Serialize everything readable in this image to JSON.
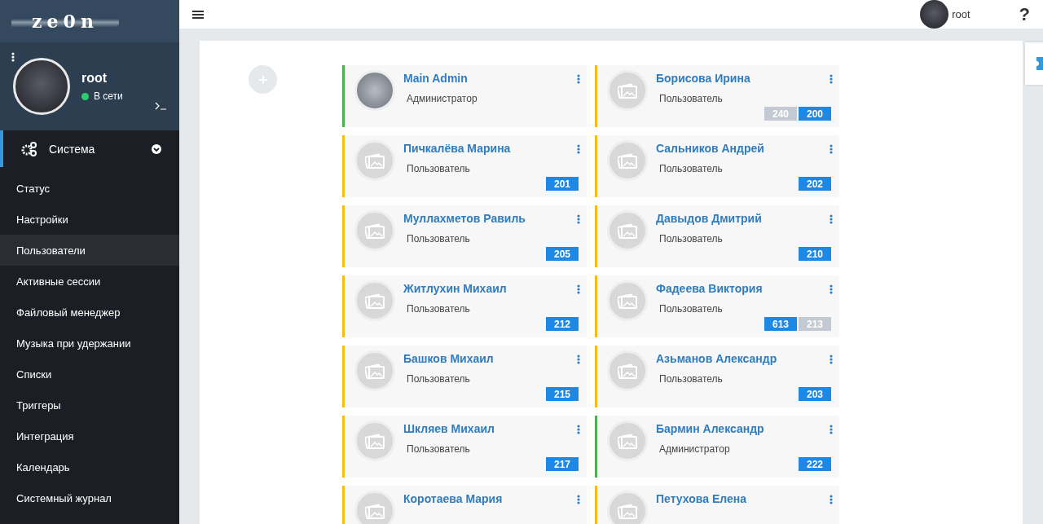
{
  "logo": {
    "text": "ze0n"
  },
  "profile": {
    "name": "root",
    "status": "В сети",
    "online": true
  },
  "header": {
    "user": "root",
    "help": "?"
  },
  "menu": {
    "section": "Система",
    "expanded": true,
    "items": [
      {
        "label": "Статус",
        "selected": false
      },
      {
        "label": "Настройки",
        "selected": false
      },
      {
        "label": "Пользователи",
        "selected": true
      },
      {
        "label": "Активные сессии",
        "selected": false
      },
      {
        "label": "Файловый менеджер",
        "selected": false
      },
      {
        "label": "Музыка при удержании",
        "selected": false
      },
      {
        "label": "Списки",
        "selected": false
      },
      {
        "label": "Триггеры",
        "selected": false
      },
      {
        "label": "Интеграция",
        "selected": false
      },
      {
        "label": "Календарь",
        "selected": false
      },
      {
        "label": "Системный журнал",
        "selected": false
      }
    ]
  },
  "users": [
    {
      "name": "Main Admin",
      "role": "Администратор",
      "kind": "admin",
      "has_photo": true
    },
    {
      "name": "Борисова Ирина",
      "role": "Пользователь",
      "kind": "user",
      "has_photo": false,
      "extensions": [
        {
          "number": "240",
          "active": false
        },
        {
          "number": "200",
          "active": true
        }
      ]
    },
    {
      "name": "Пичкалёва Марина",
      "role": "Пользователь",
      "kind": "user",
      "has_photo": false,
      "extensions": [
        {
          "number": "201",
          "active": true
        }
      ]
    },
    {
      "name": "Сальников Андрей",
      "role": "Пользователь",
      "kind": "user",
      "has_photo": false,
      "extensions": [
        {
          "number": "202",
          "active": true
        }
      ]
    },
    {
      "name": "Муллахметов Равиль",
      "role": "Пользователь",
      "kind": "user",
      "has_photo": false,
      "extensions": [
        {
          "number": "205",
          "active": true
        }
      ]
    },
    {
      "name": "Давыдов Дмитрий",
      "role": "Пользователь",
      "kind": "user",
      "has_photo": false,
      "extensions": [
        {
          "number": "210",
          "active": true
        }
      ]
    },
    {
      "name": "Житлухин Михаил",
      "role": "Пользователь",
      "kind": "user",
      "has_photo": false,
      "extensions": [
        {
          "number": "212",
          "active": true
        }
      ]
    },
    {
      "name": "Фадеева Виктория",
      "role": "Пользователь",
      "kind": "user",
      "has_photo": false,
      "extensions": [
        {
          "number": "613",
          "active": true
        },
        {
          "number": "213",
          "active": false
        }
      ]
    },
    {
      "name": "Башков Михаил",
      "role": "Пользователь",
      "kind": "user",
      "has_photo": false,
      "extensions": [
        {
          "number": "215",
          "active": true
        }
      ]
    },
    {
      "name": "Азьманов Александр",
      "role": "Пользователь",
      "kind": "user",
      "has_photo": false,
      "extensions": [
        {
          "number": "203",
          "active": true
        }
      ]
    },
    {
      "name": "Шкляев Михаил",
      "role": "Пользователь",
      "kind": "user",
      "has_photo": false,
      "extensions": [
        {
          "number": "217",
          "active": true
        }
      ]
    },
    {
      "name": "Бармин Александр",
      "role": "Администратор",
      "kind": "admin",
      "has_photo": false,
      "extensions": [
        {
          "number": "222",
          "active": true
        }
      ]
    },
    {
      "name": "Коротаева Мария",
      "kind": "user",
      "has_photo": false
    },
    {
      "name": "Петухова Елена",
      "kind": "user",
      "has_photo": false
    }
  ]
}
